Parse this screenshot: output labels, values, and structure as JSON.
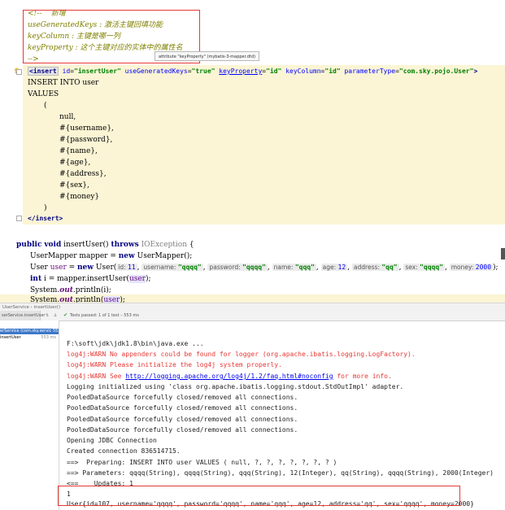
{
  "xml": {
    "tooltip": "attribute \"keyProperty\" (mybatis-3-mapper.dtd)",
    "comment": {
      "open": "<!--    新增",
      "line1": "useGeneratedKeys : 激活主键回填功能",
      "line2": "keyColumn : 主键是哪一列",
      "line3": "keyProperty : 这个主键对应的实体中的属性名",
      "close": "-->"
    },
    "insert_tag": {
      "open_bracket": "<",
      "name": "insert",
      "attr_id": "id",
      "val_id": "\"insertUser\"",
      "attr_gen": "useGeneratedKeys",
      "val_gen": "\"true\"",
      "attr_prop": "keyProperty",
      "val_prop": "\"id\"",
      "attr_col": "keyColumn",
      "val_col": "\"id\"",
      "attr_ptype": "parameterType",
      "val_ptype": "\"com.sky.pojo.User\"",
      "close_bracket": ">"
    },
    "sql": [
      "INSERT INTO user",
      "VALUES",
      "(",
      "null,",
      "#{username},",
      "#{password},",
      "#{name},",
      "#{age},",
      "#{address},",
      "#{sex},",
      "#{money}",
      ")"
    ],
    "end_tag": {
      "open": "</",
      "name": "insert",
      "close": ">"
    }
  },
  "java": {
    "sig": {
      "kw1": "public",
      "kw2": "void",
      "name": "insertUser()",
      "kw3": "throws",
      "exc": "IOException",
      "brace": "{"
    },
    "l2": {
      "a": "UserMapper mapper = ",
      "kw": "new",
      "b": " UserMapper();"
    },
    "l3": {
      "a": "User ",
      "var": "user",
      "b": " = ",
      "kw": "new",
      "c": " User(",
      "h_id": "id:",
      "v_id": "11",
      "h_un": "username:",
      "v_un": "\"qqqq\"",
      "h_pw": "password:",
      "v_pw": "\"qqqq\"",
      "h_nm": "name:",
      "v_nm": "\"qqq\"",
      "h_age": "age:",
      "v_age": "12",
      "h_addr": "address:",
      "v_addr": "\"qq\"",
      "h_sex": "sex:",
      "v_sex": "\"qqqq\"",
      "h_money": "money:",
      "v_money": "2000",
      "end": ");"
    },
    "l4": {
      "kw": "int",
      "a": " i = mapper.insertUser(",
      "var": "user",
      "b": ");"
    },
    "l5": {
      "a": "System.",
      "out": "out",
      "b": ".println(i);"
    },
    "l6": {
      "a": "System.",
      "out": "out",
      "b": ".println(",
      "var": "user",
      "c": ");"
    }
  },
  "breadcrumb": {
    "a": "UserService",
    "sep": "›",
    "b": "insertUser()"
  },
  "run": {
    "tab": "serService.insertUser",
    "status": "Tests passed: 1 of 1 test – 553 ms",
    "tree_root": "erService (com.sky.servic 553 ms",
    "tree_child": "insertUser",
    "tree_child_time": "553 ms",
    "console": [
      {
        "text": "F:\\soft\\jdk\\jdk1.8\\bin\\java.exe ...",
        "cls": ""
      },
      {
        "text": "log4j:WARN No appenders could be found for logger (org.apache.ibatis.logging.LogFactory).",
        "cls": "err"
      },
      {
        "text": "log4j:WARN Please initialize the log4j system properly.",
        "cls": "err"
      },
      {
        "text": "Logging initialized using 'class org.apache.ibatis.logging.stdout.StdOutImpl' adapter.",
        "cls": ""
      },
      {
        "text": "PooledDataSource forcefully closed/removed all connections.",
        "cls": ""
      },
      {
        "text": "PooledDataSource forcefully closed/removed all connections.",
        "cls": ""
      },
      {
        "text": "PooledDataSource forcefully closed/removed all connections.",
        "cls": ""
      },
      {
        "text": "PooledDataSource forcefully closed/removed all connections.",
        "cls": ""
      },
      {
        "text": "Opening JDBC Connection",
        "cls": ""
      },
      {
        "text": "Created connection 836514715.",
        "cls": ""
      },
      {
        "text": "==>  Preparing: INSERT INTO user VALUES ( null, ?, ?, ?, ?, ?, ?, ? )",
        "cls": ""
      },
      {
        "text": "==> Parameters: qqqq(String), qqqq(String), qqq(String), 12(Integer), qq(String), qqqq(String), 2000(Integer)",
        "cls": ""
      },
      {
        "text": "<==    Updates: 1",
        "cls": ""
      },
      {
        "text": "1",
        "cls": ""
      },
      {
        "text": "User{id=107, username='qqqq', password='qqqq', name='qqq', age=12, address='qq', sex='qqqq', money=2000}",
        "cls": ""
      }
    ],
    "log_link": {
      "pre": "log4j:WARN See ",
      "url": "http://logging.apache.org/log4j/1.2/faq.html#noconfig",
      "post": " for more info."
    }
  }
}
